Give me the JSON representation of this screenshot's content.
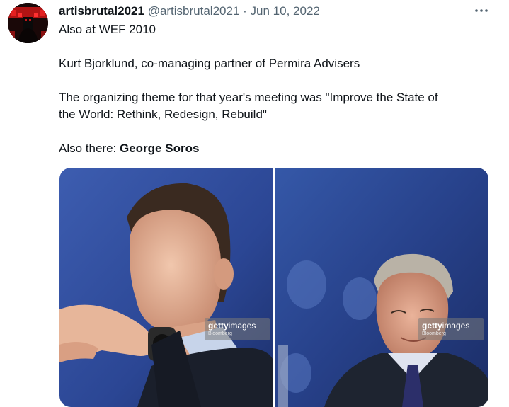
{
  "tweet": {
    "display_name": "artisbrutal2021",
    "handle": "@artisbrutal2021",
    "separator": "·",
    "date": "Jun 10, 2022",
    "lines": [
      "Also at WEF 2010",
      "Kurt Bjorklund, co-managing partner of Permira Advisers",
      "The organizing theme for that year's meeting was \"Improve the State of",
      "the World: Rethink, Redesign, Rebuild\""
    ],
    "also_there_prefix": "Also there: ",
    "also_there_name": "George Soros"
  },
  "media": {
    "watermarks": [
      {
        "brand_bold": "getty",
        "brand": "images",
        "sub": "Bloomberg"
      },
      {
        "brand_bold": "getty",
        "brand": "images",
        "sub": "Bloomberg"
      }
    ]
  },
  "icons": {
    "avatar": "avatar-icon",
    "more": "more-dots-icon"
  },
  "colors": {
    "text": "#0f1419",
    "muted": "#536471",
    "photo_bg": "#2f4a8a"
  }
}
